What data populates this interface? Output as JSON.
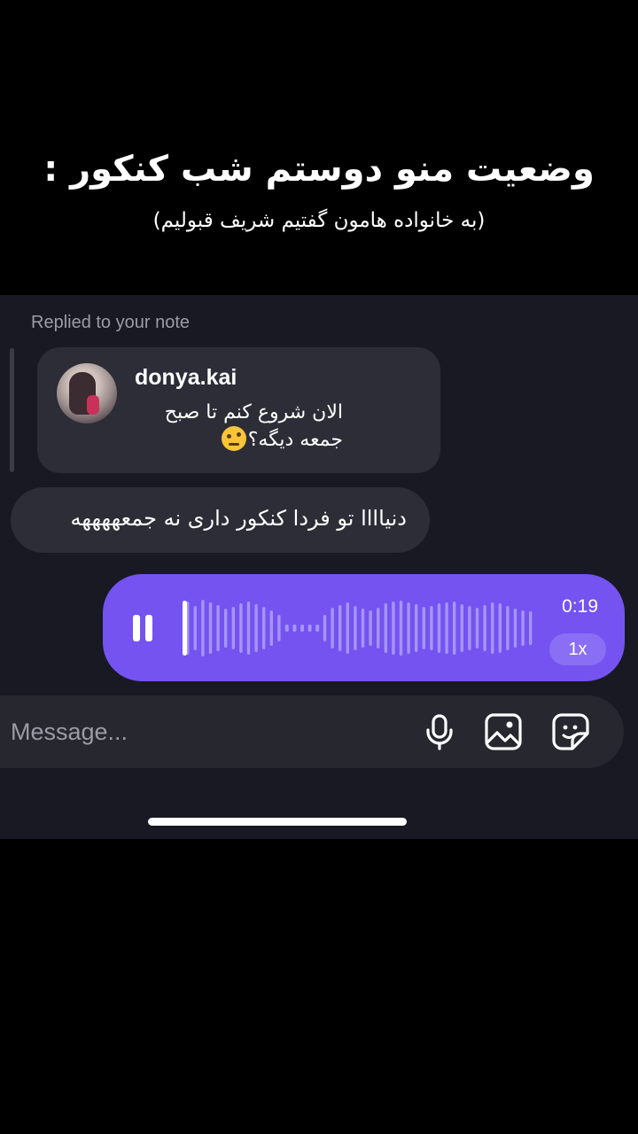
{
  "caption": {
    "title": "وضعیت منو دوستم شب کنکور :",
    "subtitle": "(به خانواده هامون گفتیم شریف قبولیم)"
  },
  "thread": {
    "replied_label": "Replied to your note",
    "note": {
      "username": "donya.kai",
      "text": "الان شروع کنم تا صبح جمعه دیگه؟",
      "emoji": "raised-eyebrow-emoji"
    },
    "incoming_message": "دنیاااا تو فردا کنکور داری نه جمعههههه",
    "voice_message": {
      "duration": "0:19",
      "speed": "1x",
      "state": "playing",
      "progress": 0
    }
  },
  "composer": {
    "placeholder": "Message...",
    "icons": [
      "microphone-icon",
      "image-icon",
      "sticker-icon"
    ]
  },
  "colors": {
    "background": "#181922",
    "bubble": "#2c2d36",
    "voice_bubble": "#7453f0",
    "caption_bg": "#000000"
  }
}
